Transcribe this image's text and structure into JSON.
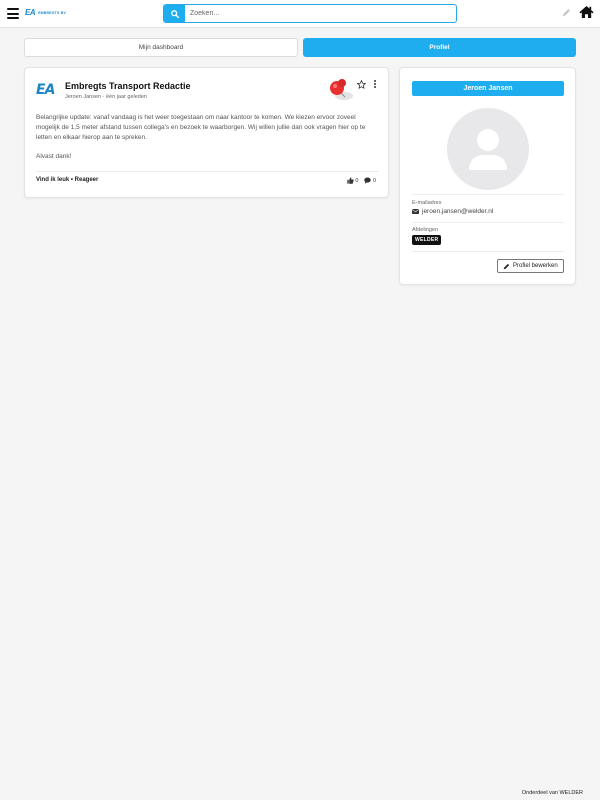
{
  "header": {
    "brand": {
      "mark": "EA",
      "text": "EMBREGTS BV"
    },
    "search": {
      "placeholder": "Zoeken...",
      "value": ""
    },
    "icons": [
      "hamburger-menu-icon",
      "search-icon",
      "pencil-icon",
      "home-icon"
    ]
  },
  "tabs": [
    {
      "label": "Mijn dashboard",
      "active": false
    },
    {
      "label": "Profiel",
      "active": true
    }
  ],
  "post": {
    "title": "Embregts Transport Redactie",
    "author": "Jeroen Jansen",
    "separator": "·",
    "time": "één jaar geleden",
    "body": [
      "Belangrijke update: vanaf vandaag is het weer toegestaan om naar kantoor te komen. We kiezen ervoor zoveel mogelijk de 1,5 meter afstand tussen collega's en bezoek te waarborgen. Wij willen jullie dan ook vragen hier op te letten en elkaar hierop aan te spreken.",
      "Alvast dank!"
    ],
    "actions": {
      "like": "Vind ik leuk",
      "dot": " • ",
      "reply": "Reageer"
    },
    "likes": "0",
    "comments": "0"
  },
  "profile": {
    "name": "Jeroen Jansen",
    "email_label": "E-mailadres",
    "email": "jeroen.jansen@welder.nl",
    "departments_label": "Afdelingen",
    "department": "WELDER",
    "edit_button": "Profiel bewerken"
  },
  "footer": {
    "text": "Onderdeel van WELDER"
  },
  "colors": {
    "accent": "#1eaef0",
    "background": "#f5f5f5",
    "card": "#ffffff",
    "pin": "#e8312f"
  }
}
